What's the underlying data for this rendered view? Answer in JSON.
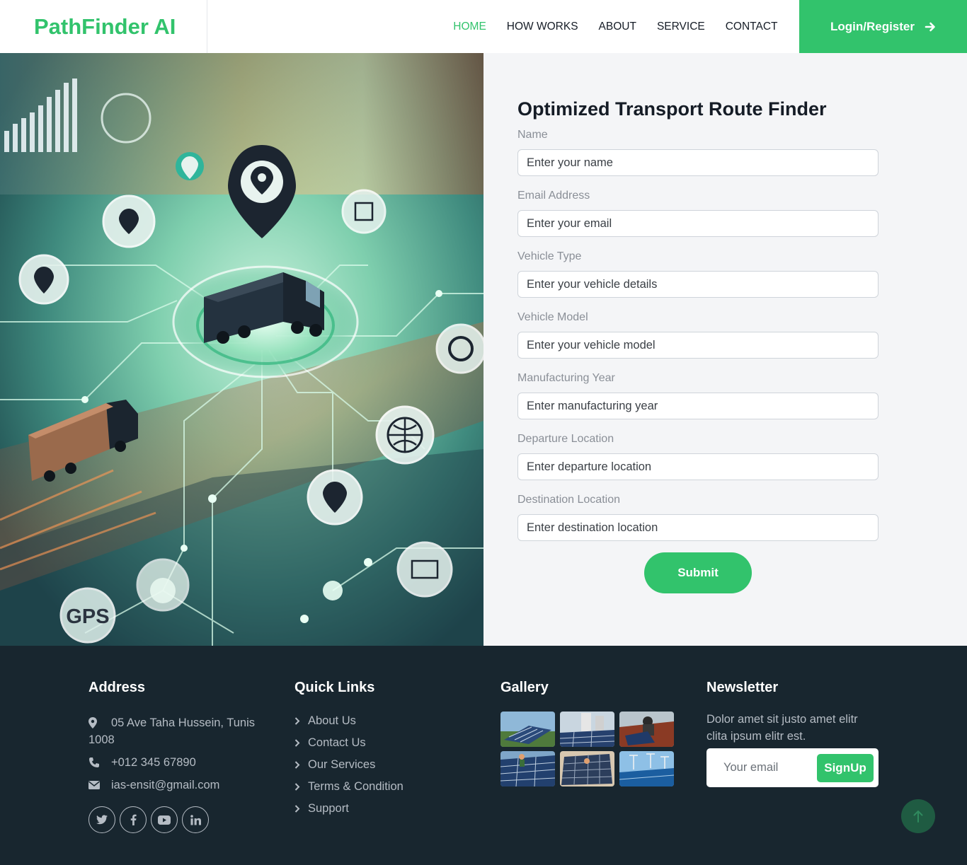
{
  "brand": {
    "name": "PathFinder AI",
    "color": "#32c36c"
  },
  "nav": {
    "items": [
      {
        "label": "HOME",
        "active": true
      },
      {
        "label": "HOW WORKS",
        "active": false
      },
      {
        "label": "ABOUT",
        "active": false
      },
      {
        "label": "SERVICE",
        "active": false
      },
      {
        "label": "CONTACT",
        "active": false
      }
    ],
    "login_label": "Login/Register",
    "login_icon": "arrow-right-icon"
  },
  "hero_image": {
    "icon": "gps-route-illustration",
    "gps_text": "GPS"
  },
  "form": {
    "title": "Optimized Transport Route Finder",
    "fields": [
      {
        "label": "Name",
        "placeholder": "Enter your name",
        "value": ""
      },
      {
        "label": "Email Address",
        "placeholder": "Enter your email",
        "value": ""
      },
      {
        "label": "Vehicle Type",
        "placeholder": "Enter your vehicle details",
        "value": ""
      },
      {
        "label": "Vehicle Model",
        "placeholder": "Enter your vehicle model",
        "value": ""
      },
      {
        "label": "Manufacturing Year",
        "placeholder": "Enter manufacturing year",
        "value": ""
      },
      {
        "label": "Departure Location",
        "placeholder": "Enter departure location",
        "value": ""
      },
      {
        "label": "Destination Location",
        "placeholder": "Enter destination location",
        "value": ""
      }
    ],
    "submit_label": "Submit"
  },
  "footer": {
    "address": {
      "title": "Address",
      "street": "05 Ave Taha Hussein, Tunis 1008",
      "phone": "+012 345 67890",
      "email": "ias-ensit@gmail.com",
      "socials": [
        "twitter-icon",
        "facebook-icon",
        "youtube-icon",
        "linkedin-icon"
      ]
    },
    "quick_links": {
      "title": "Quick Links",
      "items": [
        "About Us",
        "Contact Us",
        "Our Services",
        "Terms & Condition",
        "Support"
      ]
    },
    "gallery": {
      "title": "Gallery",
      "count": 6
    },
    "newsletter": {
      "title": "Newsletter",
      "text": "Dolor amet sit justo amet elitr clita ipsum elitr est.",
      "placeholder": "Your email",
      "button_label": "SignUp"
    }
  },
  "back_to_top_icon": "arrow-up-icon",
  "colors": {
    "accent": "#32c36c",
    "footer_bg": "#18262f",
    "form_bg": "#f4f5f7"
  }
}
